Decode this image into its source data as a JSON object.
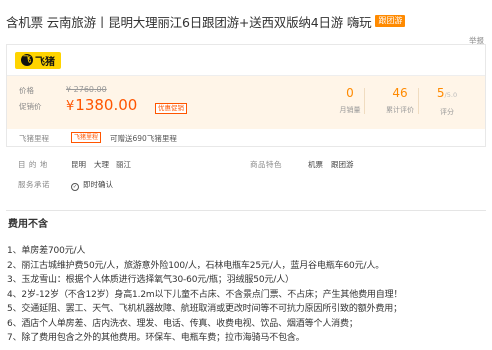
{
  "product": {
    "title": "含机票 云南旅游丨昆明大理丽江6日跟团游+送西双版纳4日游 嗨玩",
    "title_tag": "跟团游",
    "report_label": "举报",
    "brand_logo_text": "飞猪",
    "brand_logo_mark": "飞"
  },
  "pricing": {
    "price_label": "价格",
    "original_price": "¥ 2760.00",
    "sale_label": "促销价",
    "sale_currency": "¥",
    "sale_price": "1380.00",
    "promo_tag": "优惠促销"
  },
  "stats": [
    {
      "value": "0",
      "suffix": "",
      "caption": "月销量"
    },
    {
      "value": "46",
      "suffix": "",
      "caption": "累计评价"
    },
    {
      "value": "5",
      "suffix": "/5.0",
      "caption": "评分"
    }
  ],
  "mileage": {
    "label": "飞猪里程",
    "tag": "飞猪里程",
    "text": "可赠送690飞猪里程"
  },
  "details": {
    "destination_label": "目 的 地",
    "destination_values": [
      "昆明",
      "大理",
      "丽江"
    ],
    "type_label": "商品特色",
    "type_values": [
      "机票",
      "跟团游"
    ],
    "service_label": "服务承诺",
    "service_value": "即时确认"
  },
  "fees_excluded": {
    "heading": "费用不含",
    "items": [
      "1、单房差700元/人",
      "2、丽江古城维护费50元/人，旅游意外险100/人，石林电瓶车25元/人，蓝月谷电瓶车60元/人。",
      "3、玉龙雪山：根据个人体质进行选择氧气30-60元/瓶；羽绒服50元/人）",
      "4、2岁-12岁（不含12岁）身高1.2m以下儿童不占床、不含景点门票、不占床；产生其他费用自理！",
      "5、交通延阻、罢工、天气、飞机机器故障、航班取消或更改时间等不可抗力原因所引致的额外费用；",
      "6、酒店个人单房差、店内洗衣、理发、电话、传真、收费电视、饮品、烟酒等个人消费；",
      "7、除了费用包含之外的其他费用。环保车、电瓶车费；拉市海骑马不包含。"
    ]
  },
  "colors": {
    "accent": "#ff5500",
    "stat": "#ff8a00",
    "price_bg": "#fff5e8",
    "brand": "#ffd400"
  }
}
